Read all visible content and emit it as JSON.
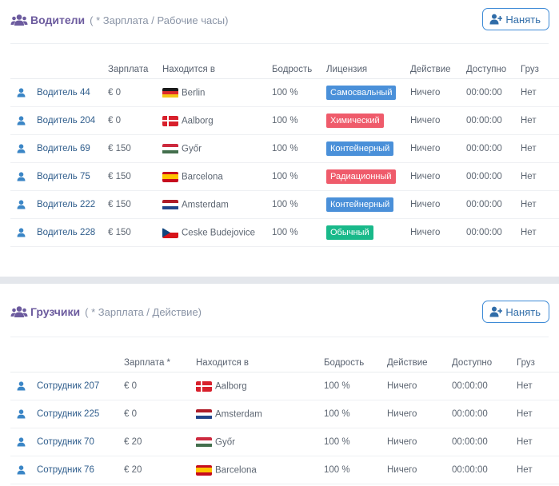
{
  "drivers": {
    "title": "Водители",
    "subtitle": "( * Зарплата / Рабочие часы)",
    "hire_label": "Нанять",
    "columns": [
      "Зарплата",
      "Находится в",
      "Бодрость",
      "Лицензия",
      "Действие",
      "Доступно",
      "Груз"
    ],
    "rows": [
      {
        "name": "Водитель 44",
        "salary": "€ 0",
        "flag": "de",
        "place": "Berlin",
        "vigor": "100 %",
        "license": "Самосвальный",
        "license_color": "blue",
        "action": "Ничего",
        "available": "00:00:00",
        "cargo": "Нет"
      },
      {
        "name": "Водитель 204",
        "salary": "€ 0",
        "flag": "dk",
        "place": "Aalborg",
        "vigor": "100 %",
        "license": "Химический",
        "license_color": "red",
        "action": "Ничего",
        "available": "00:00:00",
        "cargo": "Нет"
      },
      {
        "name": "Водитель 69",
        "salary": "€ 150",
        "flag": "hu",
        "place": "Győr",
        "vigor": "100 %",
        "license": "Контейнерный",
        "license_color": "blue",
        "action": "Ничего",
        "available": "00:00:00",
        "cargo": "Нет"
      },
      {
        "name": "Водитель 75",
        "salary": "€ 150",
        "flag": "es",
        "place": "Barcelona",
        "vigor": "100 %",
        "license": "Радиационный",
        "license_color": "red",
        "action": "Ничего",
        "available": "00:00:00",
        "cargo": "Нет"
      },
      {
        "name": "Водитель 222",
        "salary": "€ 150",
        "flag": "nl",
        "place": "Amsterdam",
        "vigor": "100 %",
        "license": "Контейнерный",
        "license_color": "blue",
        "action": "Ничего",
        "available": "00:00:00",
        "cargo": "Нет"
      },
      {
        "name": "Водитель 228",
        "salary": "€ 150",
        "flag": "cz",
        "place": "Ceske Budejovice",
        "vigor": "100 %",
        "license": "Обычный",
        "license_color": "green",
        "action": "Ничего",
        "available": "00:00:00",
        "cargo": "Нет"
      }
    ]
  },
  "loaders": {
    "title": "Грузчики",
    "subtitle": "( * Зарплата / Действие)",
    "hire_label": "Нанять",
    "columns": [
      "Зарплата *",
      "Находится в",
      "Бодрость",
      "Действие",
      "Доступно",
      "Груз"
    ],
    "rows": [
      {
        "name": "Сотрудник 207",
        "salary": "€ 0",
        "flag": "dk",
        "place": "Aalborg",
        "vigor": "100 %",
        "action": "Ничего",
        "available": "00:00:00",
        "cargo": "Нет"
      },
      {
        "name": "Сотрудник 225",
        "salary": "€ 0",
        "flag": "nl",
        "place": "Amsterdam",
        "vigor": "100 %",
        "action": "Ничего",
        "available": "00:00:00",
        "cargo": "Нет"
      },
      {
        "name": "Сотрудник 70",
        "salary": "€ 20",
        "flag": "hu",
        "place": "Győr",
        "vigor": "100 %",
        "action": "Ничего",
        "available": "00:00:00",
        "cargo": "Нет"
      },
      {
        "name": "Сотрудник 76",
        "salary": "€ 20",
        "flag": "es",
        "place": "Barcelona",
        "vigor": "100 %",
        "action": "Ничего",
        "available": "00:00:00",
        "cargo": "Нет"
      }
    ]
  },
  "colors": {
    "title": "#6c5b9e",
    "link": "#2f5d8c",
    "badge_blue": "#4a90d9",
    "badge_red": "#ef5b6b",
    "badge_green": "#19b98a",
    "button_border": "#3d8ad6"
  },
  "icons": {
    "section": "users-icon",
    "hire": "user-plus-icon",
    "row": "user-icon"
  }
}
